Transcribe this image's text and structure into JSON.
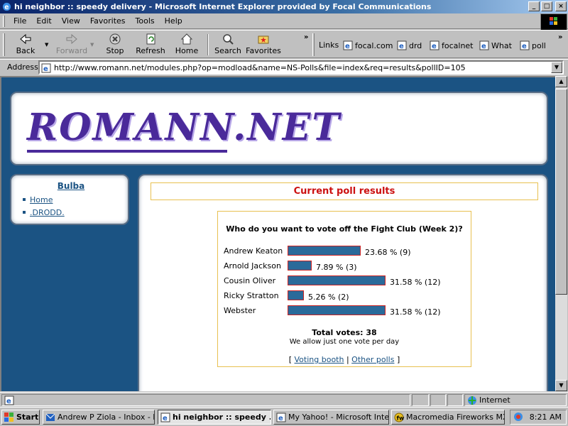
{
  "window": {
    "title": "hi neighbor :: speedy delivery - Microsoft Internet Explorer provided by Focal Communications"
  },
  "menu": {
    "items": [
      "File",
      "Edit",
      "View",
      "Favorites",
      "Tools",
      "Help"
    ]
  },
  "toolbar": {
    "back": "Back",
    "forward": "Forward",
    "stop": "Stop",
    "refresh": "Refresh",
    "home": "Home",
    "search": "Search",
    "favorites": "Favorites",
    "links_label": "Links",
    "links": [
      "focal.com",
      "drd",
      "focalnet",
      "What",
      "poll"
    ]
  },
  "address": {
    "label": "Address",
    "url": "http://www.romann.net/modules.php?op=modload&name=NS-Polls&file=index&req=results&pollID=105"
  },
  "site": {
    "logo": "ROMANN.NET",
    "sidebar": {
      "title": "Bulba",
      "links": [
        "Home",
        ".DRODD."
      ]
    },
    "results_title": "Current poll results",
    "poll": {
      "question": "Who do you want to vote off the Fight Club (Week 2)?",
      "options": [
        {
          "name": "Andrew Keaton",
          "percent": 23.68,
          "label": "23.68 % (9)"
        },
        {
          "name": "Arnold Jackson",
          "percent": 7.89,
          "label": "7.89 % (3)"
        },
        {
          "name": "Cousin Oliver",
          "percent": 31.58,
          "label": "31.58 % (12)"
        },
        {
          "name": "Ricky Stratton",
          "percent": 5.26,
          "label": "5.26 % (2)"
        },
        {
          "name": "Webster",
          "percent": 31.58,
          "label": "31.58 % (12)"
        }
      ],
      "total": "Total votes: 38",
      "note": "We allow just one vote per day",
      "voting_booth": "Voting booth",
      "other_polls": "Other polls"
    }
  },
  "status": {
    "zone": "Internet"
  },
  "taskbar": {
    "start": "Start",
    "tasks": [
      "Andrew P Ziola - Inbox - L...",
      "hi neighbor :: speedy ...",
      "My Yahoo! - Microsoft Inter...",
      "Macromedia Fireworks MX"
    ],
    "clock": "8:21 AM"
  },
  "colors": {
    "accent": "#1b5383",
    "title": "#cc1111",
    "bar": "#2a6a9a"
  }
}
